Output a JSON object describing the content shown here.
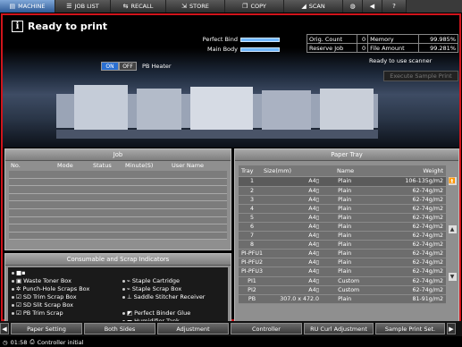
{
  "tabs": [
    {
      "label": "MACHINE",
      "icon": "machine-icon",
      "active": true
    },
    {
      "label": "JOB LIST",
      "icon": "job-list-icon",
      "active": false
    },
    {
      "label": "RECALL",
      "icon": "recall-icon",
      "active": false
    },
    {
      "label": "STORE",
      "icon": "store-icon",
      "active": false
    },
    {
      "label": "COPY",
      "icon": "copy-icon",
      "active": false
    },
    {
      "label": "SCAN",
      "icon": "scan-icon",
      "active": false
    }
  ],
  "status": {
    "message": "Ready to print"
  },
  "gauges": [
    {
      "label": "Perfect Bind",
      "level": 1.0
    },
    {
      "label": "Main Body",
      "level": 1.0
    }
  ],
  "counters": [
    {
      "label": "Orig. Count",
      "value": "0",
      "label2": "Memory",
      "value2": "99.985%"
    },
    {
      "label": "Reserve Job",
      "value": "0",
      "label2": "File Amount",
      "value2": "99.281%"
    }
  ],
  "pb_heater": {
    "on_label": "ON",
    "off_label": "OFF",
    "label": "PB Heater",
    "state": "ON"
  },
  "scanner": {
    "ready_text": "Ready to use scanner",
    "execute_label": "Execute Sample Print"
  },
  "job_panel": {
    "title": "Job",
    "columns": [
      "No.",
      "Mode",
      "Status",
      "Minute(S)",
      "User Name"
    ]
  },
  "consumables": {
    "title": "Consumable and Scrap Indicators",
    "items": [
      {
        "label": "",
        "icon": "toner-icon"
      },
      {
        "label": "Waste Toner Box",
        "icon": "waste-toner-icon"
      },
      {
        "label": "Punch-Hole Scraps Box",
        "icon": "punch-scrap-icon"
      },
      {
        "label": "SD Trim Scrap Box",
        "icon": "trim-scrap-icon"
      },
      {
        "label": "SD Slit Scrap Box",
        "icon": "slit-scrap-icon"
      },
      {
        "label": "PB Trim Scrap",
        "icon": "pb-trim-icon"
      },
      {
        "label": "Staple Cartridge",
        "icon": "staple-icon"
      },
      {
        "label": "Staple Scrap Box",
        "icon": "staple-scrap-icon"
      },
      {
        "label": "Saddle Stitcher Receiver",
        "icon": "saddle-icon"
      },
      {
        "label": "Perfect Binder Glue",
        "icon": "glue-icon"
      },
      {
        "label": "Humidifier Tank",
        "icon": "humidifier-icon"
      }
    ]
  },
  "paper_tray": {
    "title": "Paper Tray",
    "columns": [
      "Tray",
      "Size(mm)",
      "Name",
      "Weight"
    ],
    "rows": [
      {
        "tray": "1",
        "size": "A4▯",
        "name": "Plain",
        "weight": "106-135g/m2"
      },
      {
        "tray": "2",
        "size": "A4▯",
        "name": "Plain",
        "weight": "62-74g/m2"
      },
      {
        "tray": "3",
        "size": "A4▯",
        "name": "Plain",
        "weight": "62-74g/m2"
      },
      {
        "tray": "4",
        "size": "A4▯",
        "name": "Plain",
        "weight": "62-74g/m2"
      },
      {
        "tray": "5",
        "size": "A4▯",
        "name": "Plain",
        "weight": "62-74g/m2"
      },
      {
        "tray": "6",
        "size": "A4▯",
        "name": "Plain",
        "weight": "62-74g/m2"
      },
      {
        "tray": "7",
        "size": "A4▯",
        "name": "Plain",
        "weight": "62-74g/m2"
      },
      {
        "tray": "8",
        "size": "A4▯",
        "name": "Plain",
        "weight": "62-74g/m2"
      },
      {
        "tray": "PI-PFU1",
        "size": "A4▯",
        "name": "Plain",
        "weight": "62-74g/m2"
      },
      {
        "tray": "PI-PFU2",
        "size": "A4▯",
        "name": "Plain",
        "weight": "62-74g/m2"
      },
      {
        "tray": "PI-PFU3",
        "size": "A4▯",
        "name": "Plain",
        "weight": "62-74g/m2"
      },
      {
        "tray": "PI1",
        "size": "A4▯",
        "name": "Custom",
        "weight": "62-74g/m2"
      },
      {
        "tray": "PI2",
        "size": "A4▯",
        "name": "Custom",
        "weight": "62-74g/m2"
      },
      {
        "tray": "PB",
        "size": "307.0 x 472.0",
        "name": "Plain",
        "weight": "81-91g/m2"
      }
    ]
  },
  "function_bar": [
    "Paper Setting",
    "Both Sides",
    "Adjustment",
    "Controller",
    "RU Curl Adjustment",
    "Sample Print Set."
  ],
  "status_line": {
    "time": "01:58",
    "text": "Controller initial"
  }
}
